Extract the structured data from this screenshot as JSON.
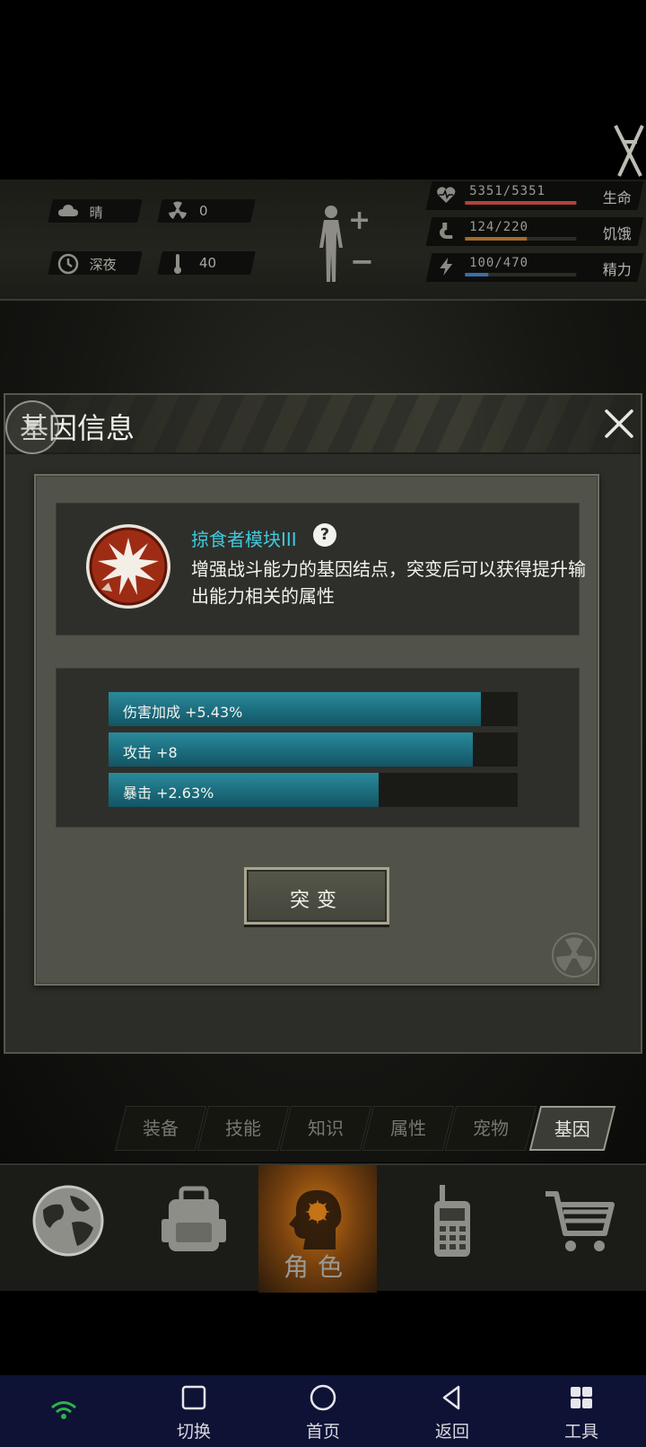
{
  "hud": {
    "weather": {
      "icon": "cloud-icon",
      "label": "晴"
    },
    "radiation": {
      "icon": "radiation-icon",
      "value": "0"
    },
    "time_of_day": {
      "icon": "clock-icon",
      "label": "深夜"
    },
    "temperature": {
      "icon": "thermometer-icon",
      "value": "40"
    },
    "vitals": [
      {
        "icon": "heart-icon",
        "value": "5351/5351",
        "label": "生命",
        "fraction": 1.0,
        "color": "#b0433a"
      },
      {
        "icon": "stomach-icon",
        "value": "124/220",
        "label": "饥饿",
        "fraction": 0.56,
        "color": "#a36b2b"
      },
      {
        "icon": "energy-icon",
        "value": "100/470",
        "label": "精力",
        "fraction": 0.21,
        "color": "#3a6fa8"
      }
    ]
  },
  "dialog": {
    "title": "基因信息",
    "gene_name": "掠食者模块III",
    "gene_desc": "增强战斗能力的基因结点，突变后可以获得提升输出能力相关的属性",
    "stats": [
      {
        "label": "伤害加成 +5.43%",
        "fraction": 0.91
      },
      {
        "label": "攻击 +8",
        "fraction": 0.89
      },
      {
        "label": "暴击 +2.63%",
        "fraction": 0.66
      }
    ],
    "mutate_label": "突变"
  },
  "tabs": [
    "装备",
    "技能",
    "知识",
    "属性",
    "宠物",
    "基因"
  ],
  "active_tab": "基因",
  "bottom_nav": {
    "role_label": "角色"
  },
  "system_bar": {
    "switch": "切换",
    "home": "首页",
    "back": "返回",
    "tools": "工具"
  },
  "colors": {
    "accent_cyan": "#3fc9de",
    "stat_bar": "#1d6f80",
    "role_glow": "#c47316",
    "system_bar_bg": "#0e1336"
  }
}
